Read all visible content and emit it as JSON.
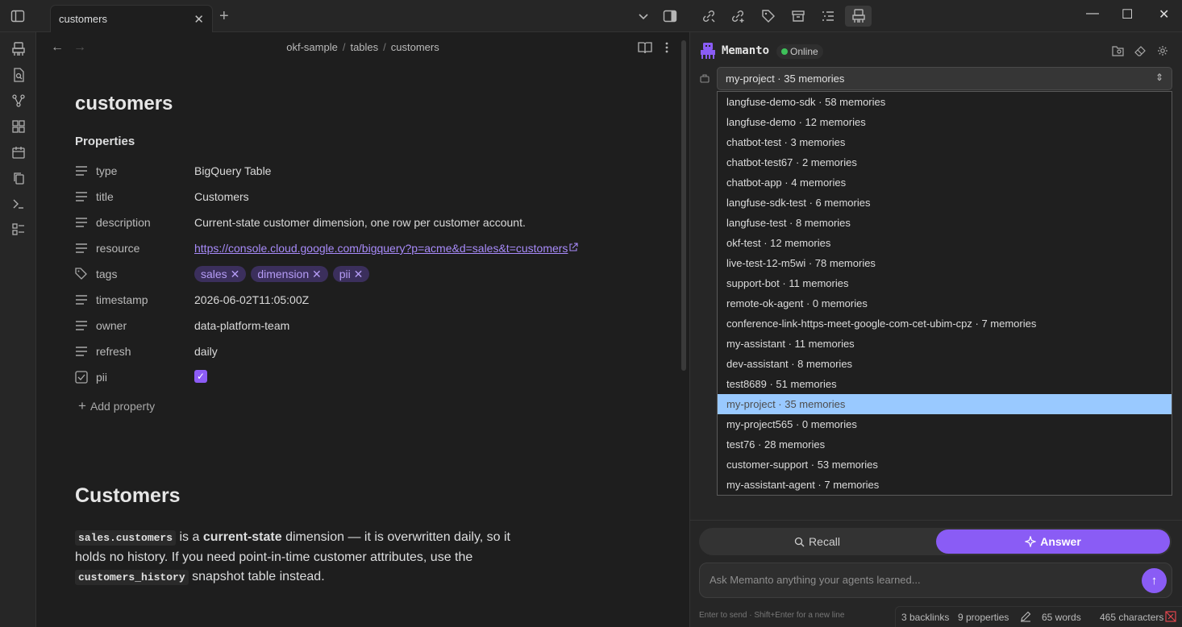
{
  "titlebar": {
    "tab_label": "customers",
    "tab_close": "✕",
    "new_tab": "+",
    "icons": [
      "sidebar-toggle-icon",
      "chevron-down-icon",
      "split-view-icon",
      "link-off-icon",
      "link-plus-icon",
      "tag-icon",
      "archive-icon",
      "list-icon",
      "memanto-icon"
    ],
    "window_controls": {
      "minimize": "—",
      "maximize": "☐",
      "close": "✕"
    }
  },
  "ribbon": {
    "icons": [
      "memanto-icon",
      "search-file-icon",
      "graph-icon",
      "grid-icon",
      "calendar-icon",
      "copy-icon",
      "terminal-icon",
      "list-layout-icon"
    ]
  },
  "editor": {
    "breadcrumb": [
      "okf-sample",
      "tables",
      "customers"
    ],
    "breadcrumb_sep": "/",
    "note_title": "customers",
    "properties_heading": "Properties",
    "properties": [
      {
        "key": "type",
        "value": "BigQuery Table"
      },
      {
        "key": "title",
        "value": "Customers"
      },
      {
        "key": "description",
        "value": "Current-state customer dimension, one row per customer account."
      },
      {
        "key": "resource",
        "value": "https://console.cloud.google.com/bigquery?p=acme&d=sales&t=customers"
      },
      {
        "key": "tags",
        "tags": [
          "sales",
          "dimension",
          "pii"
        ]
      },
      {
        "key": "timestamp",
        "value": "2026-06-02T11:05:00Z"
      },
      {
        "key": "owner",
        "value": "data-platform-team"
      },
      {
        "key": "refresh",
        "value": "daily"
      },
      {
        "key": "pii",
        "checked": true
      }
    ],
    "add_property": "Add property",
    "heading": "Customers",
    "paragraph": {
      "code1": "sales.customers",
      "t1": " is a ",
      "bold1": "current-state",
      "t2": " dimension — it is overwritten daily, so it holds no history. If you need point-in-time customer attributes, use the ",
      "code2": "customers_history",
      "t3": " snapshot table instead."
    }
  },
  "panel": {
    "app_name": "Memanto",
    "status": "Online",
    "status_color": "#3ec15a",
    "accent": "#8a5cf5",
    "selected_project": "my-project · 35 memories",
    "projects": [
      "langfuse-demo-sdk · 58 memories",
      "langfuse-demo · 12 memories",
      "chatbot-test · 3 memories",
      "chatbot-test67 · 2 memories",
      "chatbot-app · 4 memories",
      "langfuse-sdk-test · 6 memories",
      "langfuse-test · 8 memories",
      "okf-test · 12 memories",
      "live-test-12-m5wi · 78 memories",
      "support-bot · 11 memories",
      "remote-ok-agent · 0 memories",
      "conference-link-https-meet-google-com-cet-ubim-cpz · 7 memories",
      "my-assistant · 11 memories",
      "dev-assistant · 8 memories",
      "test8689 · 51 memories",
      "my-project · 35 memories",
      "my-project565 · 0 memories",
      "test76 · 28 memories",
      "customer-support · 53 memories",
      "my-assistant-agent · 7 memories"
    ],
    "selected_index": 15,
    "recall_label": "Recall",
    "answer_label": "Answer",
    "ask_placeholder": "Ask Memanto anything your agents learned...",
    "hint": "Enter to send · Shift+Enter for a new line"
  },
  "statusbar": {
    "backlinks": "3 backlinks",
    "properties": "9 properties",
    "words": "65 words",
    "characters": "465 characters"
  }
}
